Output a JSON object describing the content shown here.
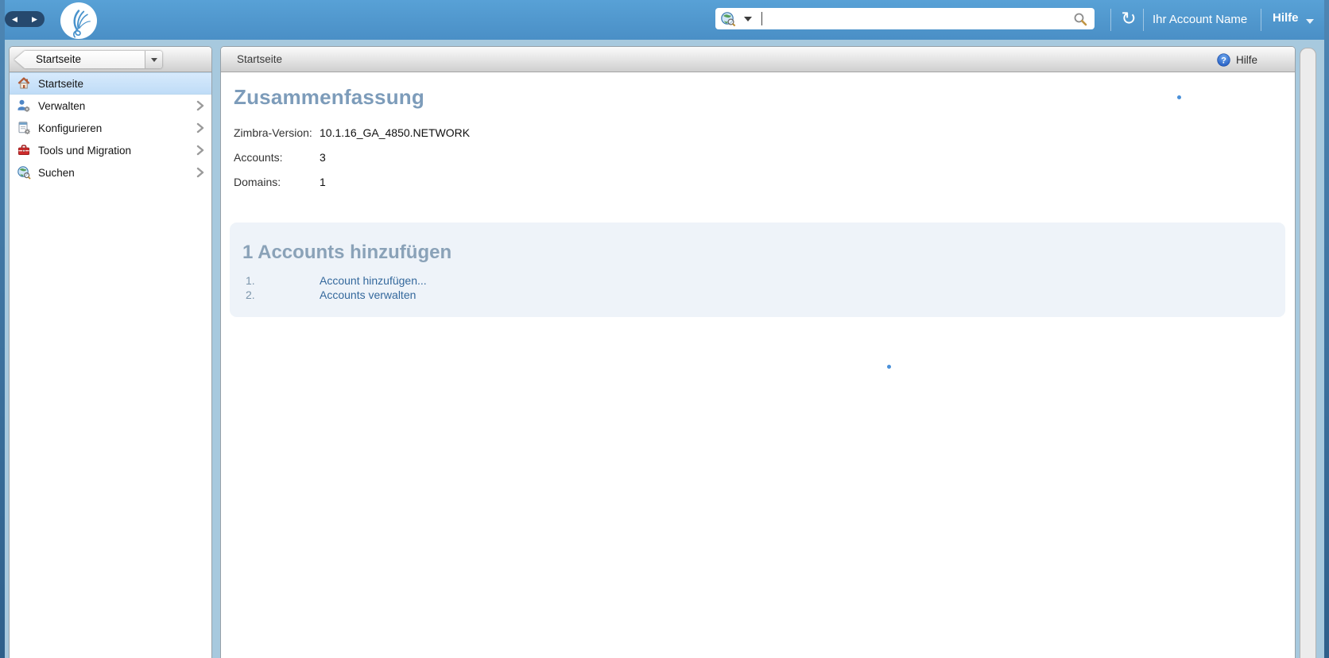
{
  "topbar": {
    "search_value": "",
    "account_name": "Ihr Account Name",
    "help_label": "Hilfe",
    "icons": [
      "back-icon",
      "forward-icon",
      "zimbra-logo",
      "globe-search-icon",
      "search-icon",
      "refresh-icon",
      "caret-down-icon"
    ]
  },
  "sidebar": {
    "selector_value": "Startseite",
    "items": [
      {
        "label": "Startseite",
        "icon": "home-icon",
        "selected": true,
        "expandable": false
      },
      {
        "label": "Verwalten",
        "icon": "user-gear-icon",
        "selected": false,
        "expandable": true
      },
      {
        "label": "Konfigurieren",
        "icon": "document-gear-icon",
        "selected": false,
        "expandable": true
      },
      {
        "label": "Tools und Migration",
        "icon": "toolbox-icon",
        "selected": false,
        "expandable": true
      },
      {
        "label": "Suchen",
        "icon": "globe-search-icon",
        "selected": false,
        "expandable": true
      }
    ]
  },
  "content": {
    "header": {
      "title": "Startseite",
      "help_label": "Hilfe",
      "help_icon": "help-icon"
    },
    "summary": {
      "title": "Zusammenfassung",
      "rows": [
        {
          "label": "Zimbra-Version:",
          "value": "10.1.16_GA_4850.NETWORK"
        },
        {
          "label": "Accounts:",
          "value": "3"
        },
        {
          "label": "Domains:",
          "value": "1"
        }
      ]
    },
    "tasks": {
      "title": "1 Accounts hinzufügen",
      "items": [
        {
          "number": "1.",
          "label": "Account hinzufügen..."
        },
        {
          "number": "2.",
          "label": "Accounts verwalten"
        }
      ]
    }
  },
  "colors": {
    "topbar_blue": "#5097ce",
    "frame_light_blue": "#a7c9de",
    "frame_dark_blue": "#2e5f8a",
    "selected_item_bg": "#c9e2f9",
    "heading_steel_blue": "#7d9cba",
    "link_blue": "#34689c",
    "tasks_panel_bg": "#eef3f9",
    "toolbox_red": "#cf2b2b"
  }
}
